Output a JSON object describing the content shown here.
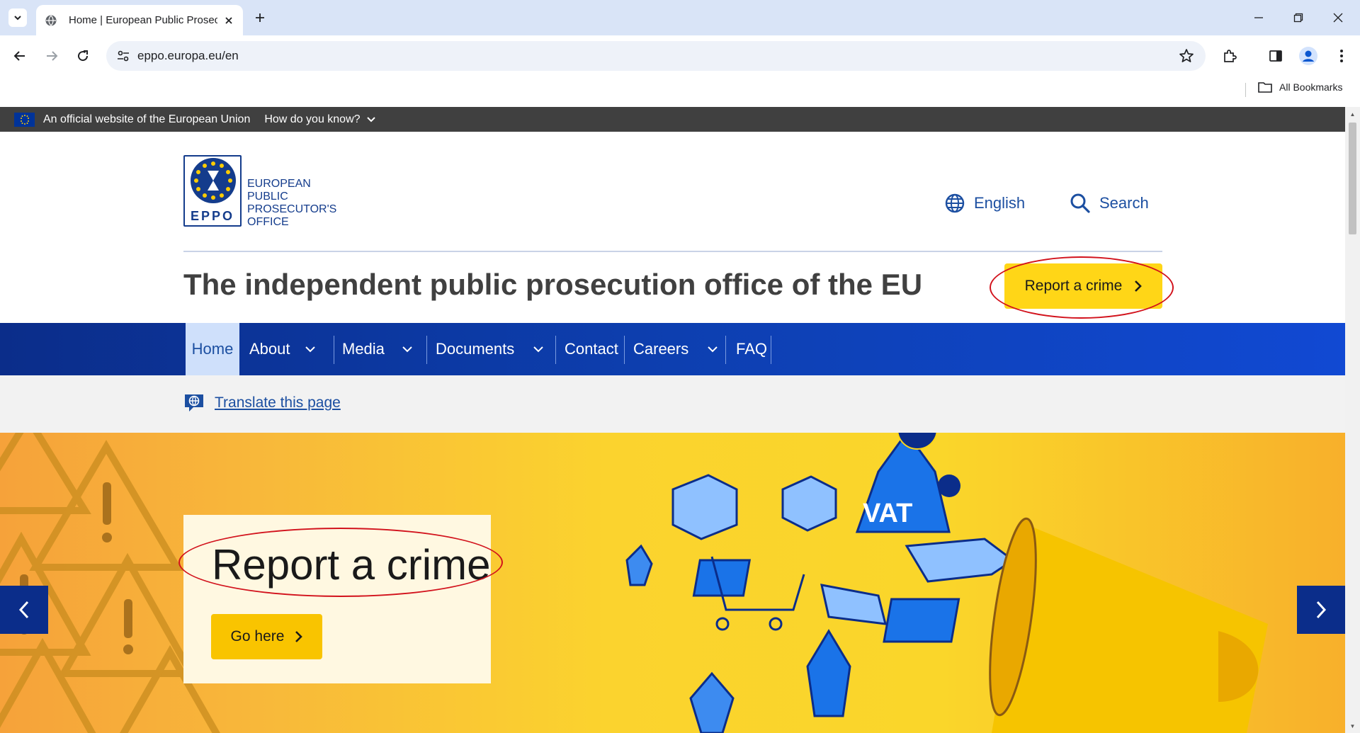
{
  "browser": {
    "tab_title": "Home | European Public Prosecutor's Office",
    "url": "eppo.europa.eu/en",
    "bookmarks_label": "All Bookmarks"
  },
  "eu_banner": {
    "official_text": "An official website of the European Union",
    "how_text": "How do you know?"
  },
  "header": {
    "logo": {
      "acronym": "EPPO",
      "line1": "EUROPEAN",
      "line2": "PUBLIC",
      "line3": "PROSECUTOR'S",
      "line4": "OFFICE"
    },
    "language_label": "English",
    "search_label": "Search",
    "tagline": "The independent public prosecution office of the EU",
    "report_button": "Report a crime"
  },
  "nav": {
    "items": [
      {
        "label": "Home"
      },
      {
        "label": "About"
      },
      {
        "label": "Media"
      },
      {
        "label": "Documents"
      },
      {
        "label": "Contact"
      },
      {
        "label": "Careers"
      },
      {
        "label": "FAQ"
      }
    ]
  },
  "translate": {
    "label": "Translate this page"
  },
  "hero": {
    "heading": "Report a crime",
    "button": "Go here",
    "art_text": "VAT"
  },
  "colors": {
    "eu_blue": "#0b2d8a",
    "link_blue": "#1c4fa1",
    "accent_yellow": "#ffd617",
    "annotation_red": "#d2121c"
  }
}
